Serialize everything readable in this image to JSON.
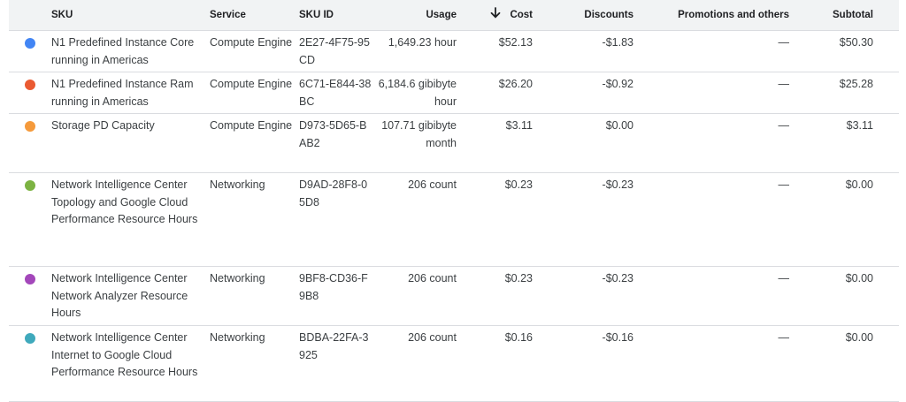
{
  "header": {
    "sku": "SKU",
    "service": "Service",
    "sku_id": "SKU ID",
    "usage": "Usage",
    "cost": "Cost",
    "discounts": "Discounts",
    "promotions": "Promotions and others",
    "subtotal": "Subtotal",
    "sort_icon": "arrow-down-icon"
  },
  "rows": [
    {
      "color": "#4285f4",
      "sku": "N1 Predefined Instance Core running in Americas",
      "service": "Compute Engine",
      "sku_id": "2E27-4F75-95CD",
      "usage": "1,649.23 hour",
      "cost": "$52.13",
      "discounts": "-$1.83",
      "promotions": "—",
      "subtotal": "$50.30"
    },
    {
      "color": "#ea5a32",
      "sku": "N1 Predefined Instance Ram running in Americas",
      "service": "Compute Engine",
      "sku_id": "6C71-E844-38BC",
      "usage": "6,184.6 gibibyte hour",
      "cost": "$26.20",
      "discounts": "-$0.92",
      "promotions": "—",
      "subtotal": "$25.28"
    },
    {
      "color": "#f59a3b",
      "sku": "Storage PD Capacity",
      "service": "Compute Engine",
      "sku_id": "D973-5D65-BAB2",
      "usage": "107.71 gibibyte month",
      "cost": "$3.11",
      "discounts": "$0.00",
      "promotions": "—",
      "subtotal": "$3.11"
    },
    {
      "color": "#7cb342",
      "sku": "Network Intelligence Center Topology and Google Cloud Performance Resource Hours",
      "service": "Networking",
      "sku_id": "D9AD-28F8-05D8",
      "usage": "206 count",
      "cost": "$0.23",
      "discounts": "-$0.23",
      "promotions": "—",
      "subtotal": "$0.00"
    },
    {
      "color": "#a347ba",
      "sku": "Network Intelligence Center Network Analyzer Resource Hours",
      "service": "Networking",
      "sku_id": "9BF8-CD36-F9B8",
      "usage": "206 count",
      "cost": "$0.23",
      "discounts": "-$0.23",
      "promotions": "—",
      "subtotal": "$0.00"
    },
    {
      "color": "#3fa9bc",
      "sku": "Network Intelligence Center Internet to Google Cloud Performance Resource Hours",
      "service": "Networking",
      "sku_id": "BDBA-22FA-3925",
      "usage": "206 count",
      "cost": "$0.16",
      "discounts": "-$0.16",
      "promotions": "—",
      "subtotal": "$0.00"
    }
  ]
}
